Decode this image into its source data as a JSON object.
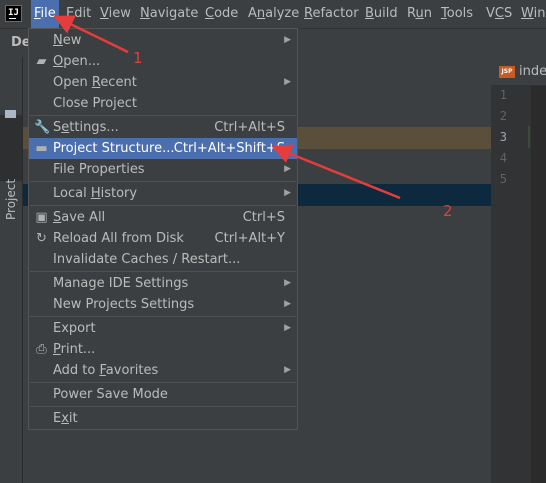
{
  "menubar": {
    "items": [
      {
        "label": "File",
        "mnemonic": 0,
        "active": true
      },
      {
        "label": "Edit",
        "mnemonic": 0
      },
      {
        "label": "View",
        "mnemonic": 0
      },
      {
        "label": "Navigate",
        "mnemonic": 0
      },
      {
        "label": "Code",
        "mnemonic": 0
      },
      {
        "label": "Analyze",
        "mnemonic": 1
      },
      {
        "label": "Refactor",
        "mnemonic": 0
      },
      {
        "label": "Build",
        "mnemonic": 0
      },
      {
        "label": "Run",
        "mnemonic": 1
      },
      {
        "label": "Tools",
        "mnemonic": 0
      },
      {
        "label": "VCS",
        "mnemonic": 1
      },
      {
        "label": "Wind",
        "mnemonic": 0
      }
    ]
  },
  "logo": {
    "text": "IJ"
  },
  "breadcrumb": {
    "text": "De"
  },
  "side_tab": {
    "label": "Project"
  },
  "editor": {
    "tab_label": "index",
    "tab_icon_text": "JSP",
    "line_numbers": [
      "1",
      "2",
      "3",
      "4",
      "5"
    ],
    "current_line": "3"
  },
  "file_menu": {
    "items": [
      {
        "type": "item",
        "label": "New",
        "mnemonic": 0,
        "submenu": true
      },
      {
        "type": "item",
        "label": "Open...",
        "mnemonic": 0,
        "icon": "folder-open-icon"
      },
      {
        "type": "item",
        "label": "Open Recent",
        "mnemonic": 5,
        "submenu": true
      },
      {
        "type": "item",
        "label": "Close Project"
      },
      {
        "type": "separator"
      },
      {
        "type": "item",
        "label": "Settings...",
        "mnemonic": 1,
        "shortcut": "Ctrl+Alt+S",
        "icon": "wrench-icon"
      },
      {
        "type": "item",
        "label": "Project Structure...",
        "shortcut": "Ctrl+Alt+Shift+S",
        "icon": "project-structure-icon",
        "selected": true
      },
      {
        "type": "item",
        "label": "File Properties",
        "submenu": true
      },
      {
        "type": "separator"
      },
      {
        "type": "item",
        "label": "Local History",
        "mnemonic": 6,
        "submenu": true
      },
      {
        "type": "separator"
      },
      {
        "type": "item",
        "label": "Save All",
        "mnemonic": 0,
        "shortcut": "Ctrl+S",
        "icon": "save-icon"
      },
      {
        "type": "item",
        "label": "Reload All from Disk",
        "shortcut": "Ctrl+Alt+Y",
        "icon": "reload-icon"
      },
      {
        "type": "item",
        "label": "Invalidate Caches / Restart..."
      },
      {
        "type": "separator"
      },
      {
        "type": "item",
        "label": "Manage IDE Settings",
        "submenu": true
      },
      {
        "type": "item",
        "label": "New Projects Settings",
        "submenu": true
      },
      {
        "type": "separator"
      },
      {
        "type": "item",
        "label": "Export",
        "submenu": true
      },
      {
        "type": "item",
        "label": "Print...",
        "mnemonic": 0,
        "icon": "print-icon"
      },
      {
        "type": "item",
        "label": "Add to Favorites",
        "mnemonic": 7,
        "submenu": true
      },
      {
        "type": "separator"
      },
      {
        "type": "item",
        "label": "Power Save Mode"
      },
      {
        "type": "separator"
      },
      {
        "type": "item",
        "label": "Exit",
        "mnemonic": 1
      }
    ]
  },
  "annotations": {
    "label_1": "1",
    "label_2": "2",
    "color": "#e53c3c"
  },
  "colors": {
    "accent": "#4b6eaf",
    "menu_bg": "#3c3f41",
    "editor_bg": "#2b2b2b"
  }
}
